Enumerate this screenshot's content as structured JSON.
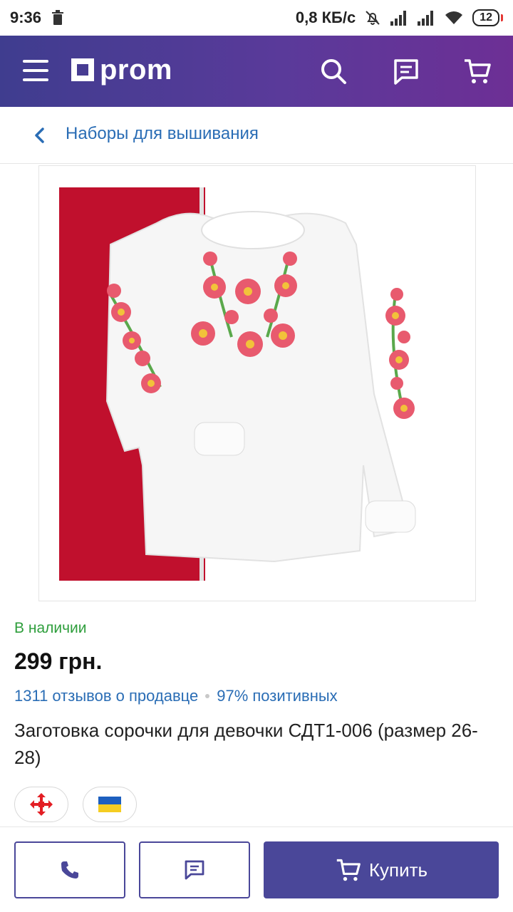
{
  "status_bar": {
    "time": "9:36",
    "network_speed": "0,8 КБ/с",
    "battery_level": "12"
  },
  "header": {
    "logo_text": "prom",
    "icons": [
      "menu-icon",
      "search-icon",
      "chat-icon",
      "cart-icon"
    ]
  },
  "breadcrumb": {
    "label": "Наборы для вышивания"
  },
  "product": {
    "availability": "В наличии",
    "price": "299 грн.",
    "reviews_link": "1311 отзывов о продавце",
    "positive_percent": "97% позитивных",
    "title": "Заготовка сорочки для девочки СДТ1-006 (размер 26-28)"
  },
  "badges": [
    "nova-poshta-icon",
    "ukraine-flag-icon"
  ],
  "actions": {
    "buy_label": "Купить"
  },
  "colors": {
    "header_gradient_start": "#3f3d8f",
    "header_gradient_end": "#6d2f95",
    "primary_button": "#4a4799",
    "link": "#2a6db5",
    "availability": "#2e9e3c"
  }
}
